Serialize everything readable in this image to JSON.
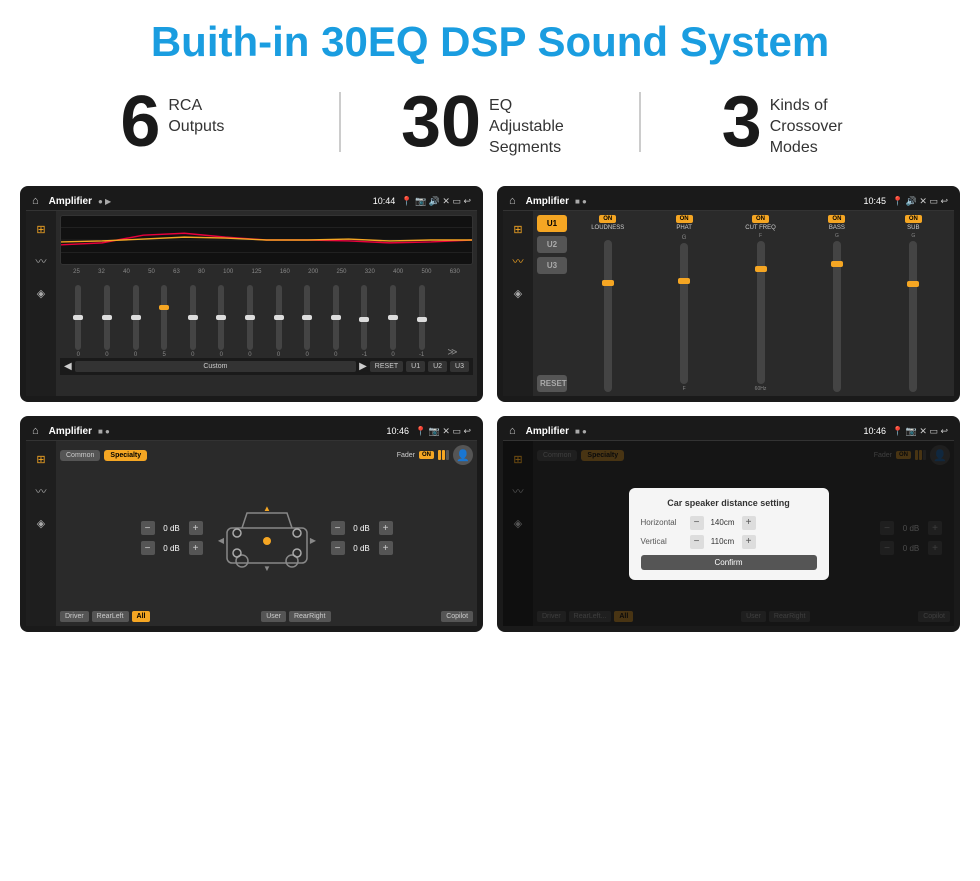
{
  "header": {
    "title": "Buith-in 30EQ DSP Sound System"
  },
  "stats": [
    {
      "number": "6",
      "text": "RCA\nOutputs"
    },
    {
      "number": "30",
      "text": "EQ Adjustable\nSegments"
    },
    {
      "number": "3",
      "text": "Kinds of\nCrossover Modes"
    }
  ],
  "screens": {
    "screen1": {
      "appName": "Amplifier",
      "time": "10:44",
      "freqLabels": [
        "25",
        "32",
        "40",
        "50",
        "63",
        "80",
        "100",
        "125",
        "160",
        "200",
        "250",
        "320",
        "400",
        "500",
        "630"
      ],
      "sliderVals": [
        "0",
        "0",
        "0",
        "5",
        "0",
        "0",
        "0",
        "0",
        "0",
        "0",
        "-1",
        "0",
        "-1"
      ],
      "bottomBtns": [
        "Custom",
        "RESET",
        "U1",
        "U2",
        "U3"
      ]
    },
    "screen2": {
      "appName": "Amplifier",
      "time": "10:45",
      "presets": [
        "U1",
        "U2",
        "U3"
      ],
      "controls": [
        {
          "label": "LOUDNESS",
          "on": true
        },
        {
          "label": "PHAT",
          "on": true
        },
        {
          "label": "CUT FREQ",
          "on": true
        },
        {
          "label": "BASS",
          "on": true
        },
        {
          "label": "SUB",
          "on": true
        }
      ],
      "resetLabel": "RESET"
    },
    "screen3": {
      "appName": "Amplifier",
      "time": "10:46",
      "modes": [
        "Common",
        "Specialty"
      ],
      "faderLabel": "Fader",
      "volLeft1": "0 dB",
      "volLeft2": "0 dB",
      "volRight1": "0 dB",
      "volRight2": "0 dB",
      "bottomBtns": [
        "Driver",
        "RearLeft",
        "All",
        "User",
        "RearRight",
        "Copilot"
      ]
    },
    "screen4": {
      "appName": "Amplifier",
      "time": "10:46",
      "modes": [
        "Common",
        "Specialty"
      ],
      "faderLabel": "Fader",
      "volRight1": "0 dB",
      "volRight2": "0 dB",
      "dialog": {
        "title": "Car speaker distance setting",
        "horizontal": {
          "label": "Horizontal",
          "value": "140cm"
        },
        "vertical": {
          "label": "Vertical",
          "value": "110cm"
        },
        "confirmLabel": "Confirm"
      },
      "bottomBtns": [
        "Driver",
        "RearLeft...",
        "All",
        "User",
        "RearRight",
        "Copilot"
      ]
    }
  },
  "icons": {
    "home": "⌂",
    "play": "▶",
    "eq": "≋",
    "wave": "≈",
    "speaker": "◈",
    "back": "↩",
    "chevronLeft": "◀",
    "chevronRight": "▶",
    "chevronDown": "▼",
    "location": "📍",
    "camera": "📷",
    "volume": "🔊",
    "close": "✕",
    "window": "▭",
    "minus": "−",
    "plus": "+"
  }
}
